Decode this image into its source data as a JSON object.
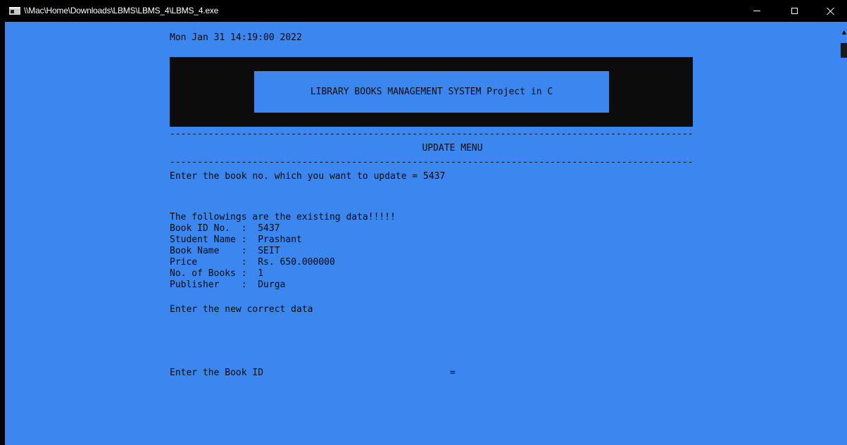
{
  "window": {
    "title": "\\\\Mac\\Home\\Downloads\\LBMS\\LBMS_4\\LBMS_4.exe"
  },
  "console": {
    "timestamp": "Mon Jan 31 14:19:00 2022",
    "header_title": "LIBRARY BOOKS MANAGEMENT SYSTEM Project in C",
    "dashes": "--------------------------------------------------------------------------------------------------------",
    "menu_title": "UPDATE MENU",
    "prompt_book_no": "Enter the book no. which you want to update = 5437",
    "existing_heading": "The followings are the existing data!!!!!",
    "fields": [
      {
        "label": "Book ID No.  ",
        "sep": ":",
        "value": "5437"
      },
      {
        "label": "Student Name ",
        "sep": ":",
        "value": "Prashant"
      },
      {
        "label": "Book Name    ",
        "sep": ":",
        "value": "SEIT"
      },
      {
        "label": "Price        ",
        "sep": ":",
        "value": "Rs. 650.000000"
      },
      {
        "label": "No. of Books ",
        "sep": ":",
        "value": "1"
      },
      {
        "label": "Publisher    ",
        "sep": ":",
        "value": "Durga"
      }
    ],
    "new_data_prompt": "Enter the new correct data",
    "book_id_prompt": "Enter the Book ID",
    "book_id_equals": "="
  },
  "icons": {
    "app": "console-app-icon",
    "minimize": "minimize-icon",
    "maximize": "maximize-icon",
    "close": "close-icon"
  }
}
